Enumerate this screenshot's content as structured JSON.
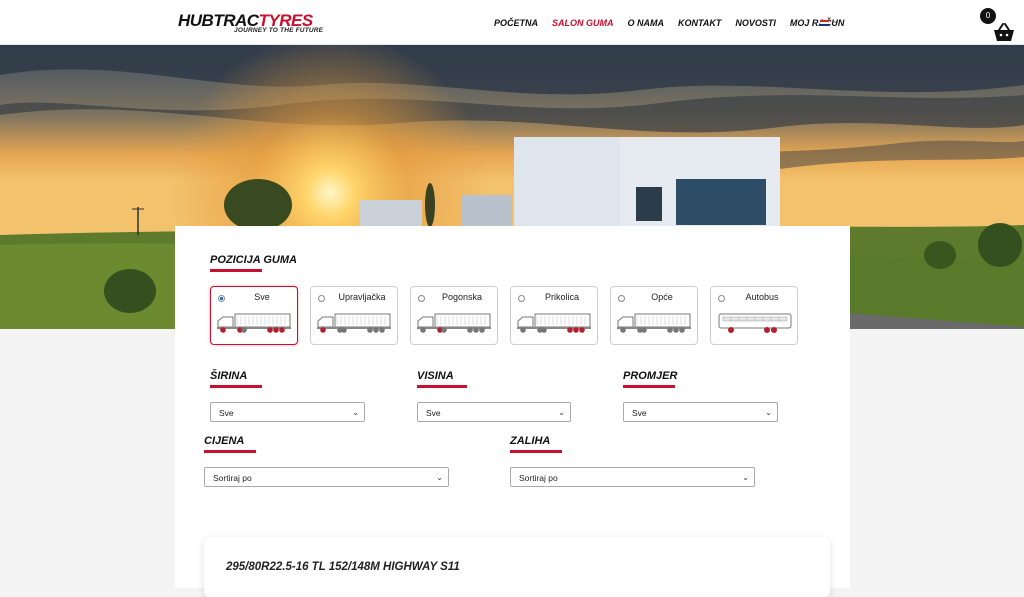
{
  "brand": {
    "logo_part1": "HUBTRAC",
    "logo_part2": "TYRES",
    "tagline": "JOURNEY TO THE FUTURE"
  },
  "nav": {
    "items": [
      {
        "label": "POČETNA",
        "active": false
      },
      {
        "label": "SALON GUMA",
        "active": true
      },
      {
        "label": "O NAMA",
        "active": false
      },
      {
        "label": "KONTAKT",
        "active": false
      },
      {
        "label": "NOVOSTI",
        "active": false
      },
      {
        "label": "MOJ RAČUN",
        "active": false
      }
    ],
    "language_flag": "croatian-flag-icon"
  },
  "cart": {
    "count": "0",
    "icon": "basket-icon"
  },
  "colors": {
    "accent": "#c8102e",
    "text": "#111111"
  },
  "position_section": {
    "title": "POZICIJA GUMA",
    "options": [
      {
        "label": "Sve",
        "selected": true,
        "icon": "truck-all-wheels-icon"
      },
      {
        "label": "Upravljačka",
        "selected": false,
        "icon": "truck-steer-wheel-icon"
      },
      {
        "label": "Pogonska",
        "selected": false,
        "icon": "truck-drive-wheel-icon"
      },
      {
        "label": "Prikolica",
        "selected": false,
        "icon": "truck-trailer-wheel-icon"
      },
      {
        "label": "Opće",
        "selected": false,
        "icon": "truck-general-wheel-icon"
      },
      {
        "label": "Autobus",
        "selected": false,
        "icon": "bus-wheel-icon"
      }
    ]
  },
  "filters": {
    "sirina": {
      "title": "ŠIRINA",
      "value": "Sve"
    },
    "visina": {
      "title": "VISINA",
      "value": "Sve"
    },
    "promjer": {
      "title": "PROMJER",
      "value": "Sve"
    },
    "cijena": {
      "title": "CIJENA",
      "value": "Sortiraj po"
    },
    "zaliha": {
      "title": "ZALIHA",
      "value": "Sortiraj po"
    }
  },
  "product": {
    "name": "295/80R22.5-16 TL 152/148M HIGHWAY S11"
  }
}
